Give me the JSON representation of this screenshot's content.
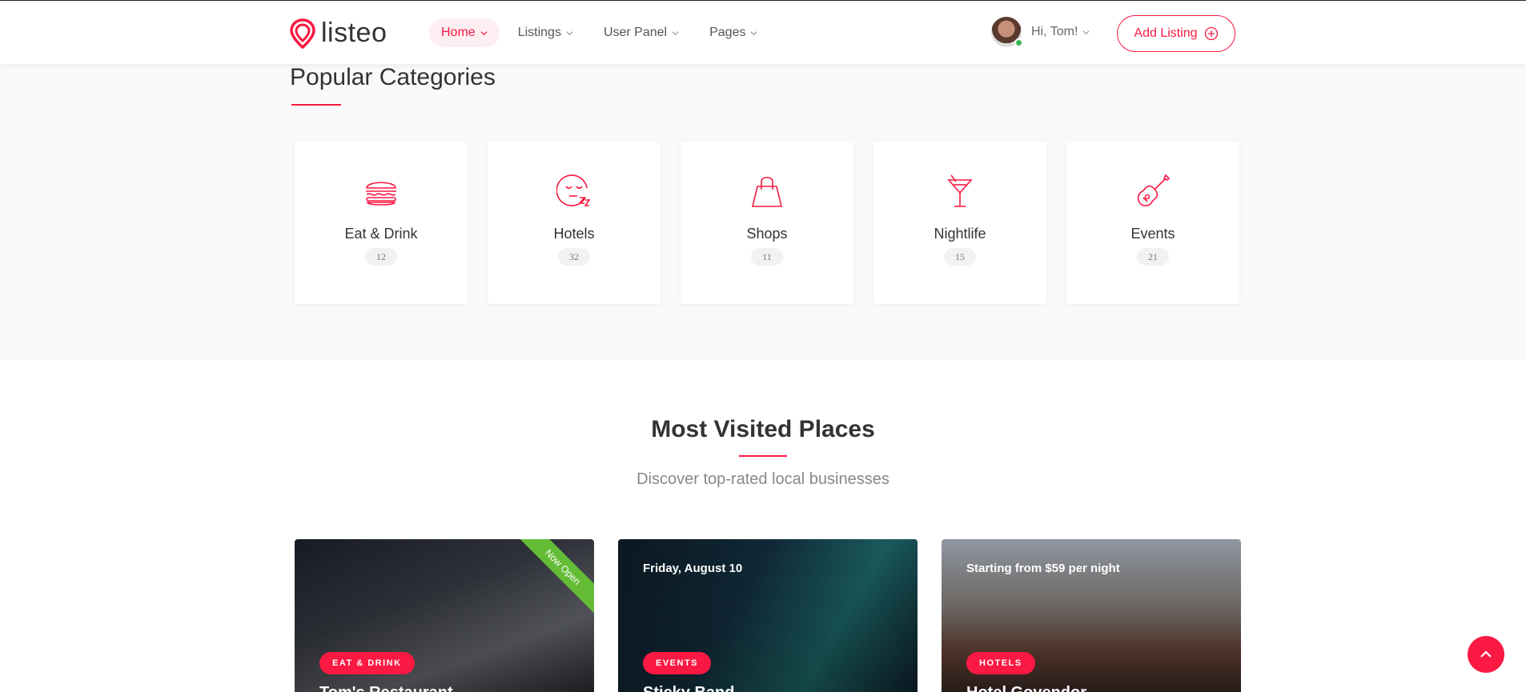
{
  "header": {
    "logo_text": "listeo",
    "nav": [
      {
        "label": "Home"
      },
      {
        "label": "Listings"
      },
      {
        "label": "User Panel"
      },
      {
        "label": "Pages"
      }
    ],
    "user_greeting": "Hi, Tom!",
    "add_listing_label": "Add Listing"
  },
  "categories": {
    "title": "Popular Categories",
    "items": [
      {
        "name": "Eat & Drink",
        "count": "12",
        "icon": "burger-icon"
      },
      {
        "name": "Hotels",
        "count": "32",
        "icon": "sleep-icon"
      },
      {
        "name": "Shops",
        "count": "11",
        "icon": "shopping-bag-icon"
      },
      {
        "name": "Nightlife",
        "count": "15",
        "icon": "cocktail-icon"
      },
      {
        "name": "Events",
        "count": "21",
        "icon": "guitar-icon"
      }
    ]
  },
  "most_visited": {
    "title": "Most Visited Places",
    "subtitle": "Discover top-rated local businesses",
    "places": [
      {
        "top_text": "",
        "ribbon": "Now Open",
        "tag": "EAT & DRINK",
        "name": "Tom's Restaurant"
      },
      {
        "top_text": "Friday, August 10",
        "ribbon": "",
        "tag": "EVENTS",
        "name": "Sticky Band"
      },
      {
        "top_text": "Starting from $59 per night",
        "ribbon": "",
        "tag": "HOTELS",
        "name": "Hotel Govendor"
      }
    ]
  },
  "colors": {
    "accent": "#f91942",
    "ribbon": "#64bc36",
    "section_bg": "#f9f9f9"
  }
}
